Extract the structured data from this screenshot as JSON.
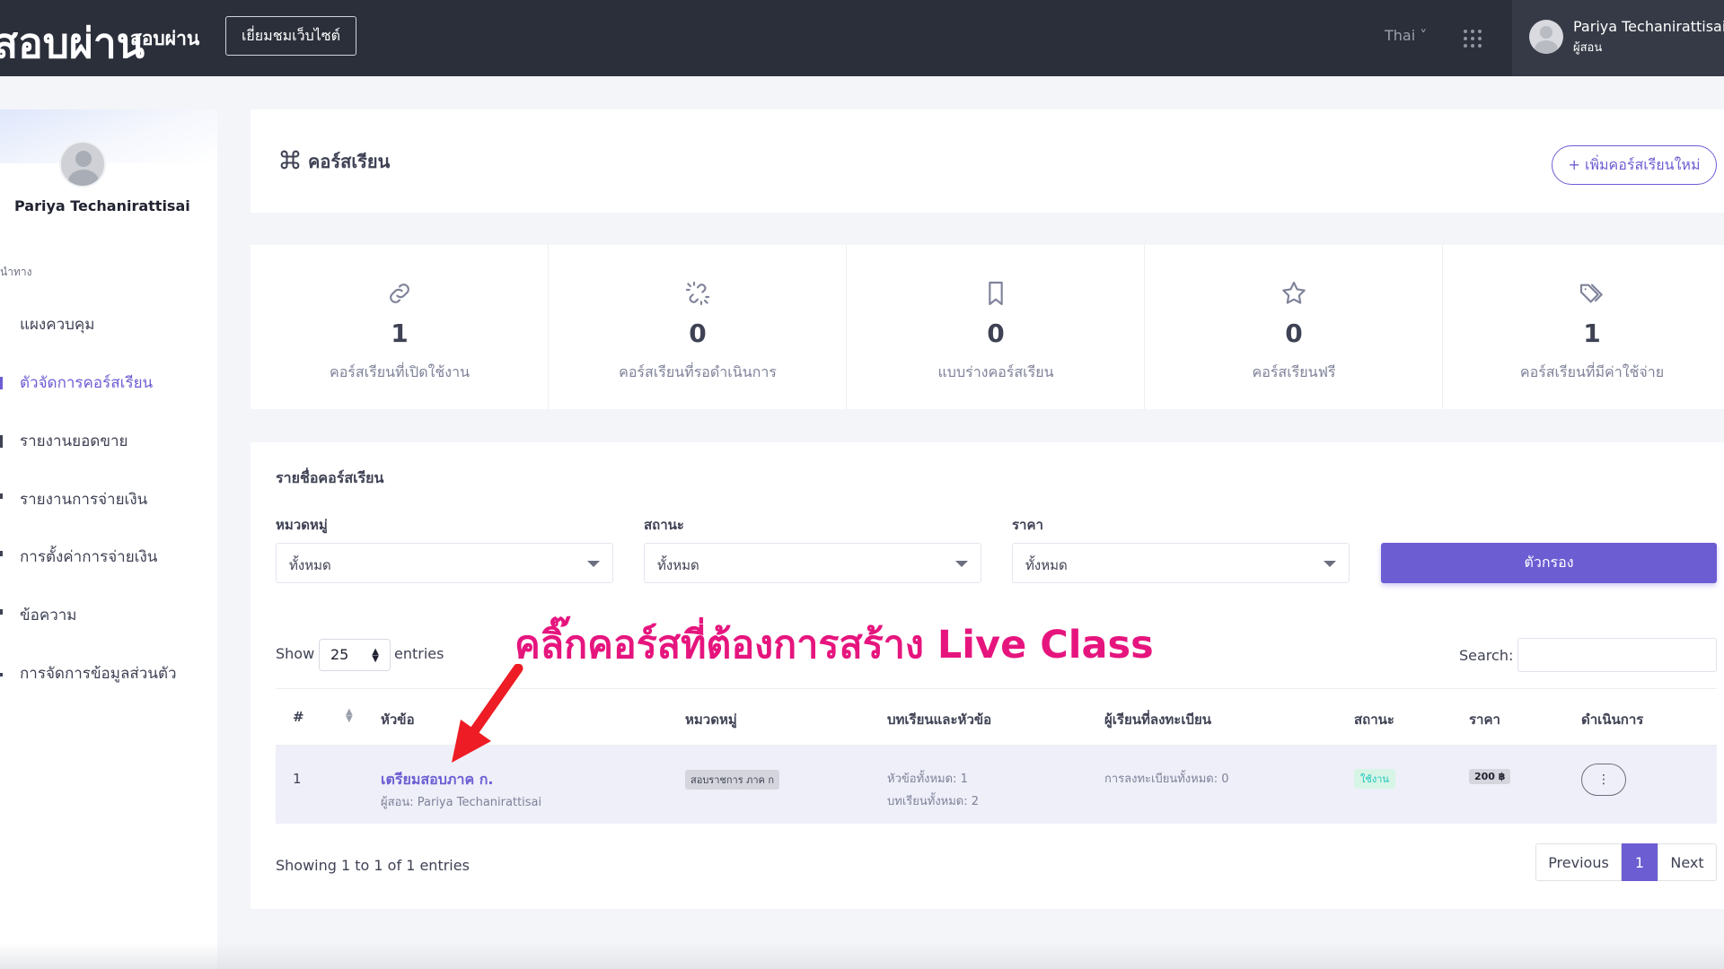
{
  "topbar": {
    "logo_text": "สอบผ่าน",
    "brand_text": "สอบผ่าน",
    "visit_button": "เยี่ยมชมเว็บไซต์",
    "language": "Thai ˅",
    "user_name": "Pariya Techanirattisai",
    "user_role": "ผู้สอน"
  },
  "sidebar": {
    "profile_name": "Pariya Techanirattisai",
    "nav_title": "นำทาง",
    "items": [
      {
        "label": "แผงควบคุม",
        "active": false
      },
      {
        "label": "ตัวจัดการคอร์สเรียน",
        "active": true
      },
      {
        "label": "รายงานยอดขาย",
        "active": false
      },
      {
        "label": "รายงานการจ่ายเงิน",
        "active": false
      },
      {
        "label": "การตั้งค่าการจ่ายเงิน",
        "active": false
      },
      {
        "label": "ข้อความ",
        "active": false
      },
      {
        "label": "การจัดการข้อมูลส่วนตัว",
        "active": false
      }
    ]
  },
  "header": {
    "title": "คอร์สเรียน",
    "add_button": "+ เพิ่มคอร์สเรียนใหม่"
  },
  "stats": [
    {
      "icon": "link-icon",
      "value": "1",
      "label": "คอร์สเรียนที่เปิดใช้งาน"
    },
    {
      "icon": "broken-link-icon",
      "value": "0",
      "label": "คอร์สเรียนที่รอดำเนินการ"
    },
    {
      "icon": "bookmark-icon",
      "value": "0",
      "label": "แบบร่างคอร์สเรียน"
    },
    {
      "icon": "star-icon",
      "value": "0",
      "label": "คอร์สเรียนฟรี"
    },
    {
      "icon": "tags-icon",
      "value": "1",
      "label": "คอร์สเรียนที่มีค่าใช้จ่าย"
    }
  ],
  "list": {
    "title": "รายชื่อคอร์สเรียน",
    "filters": {
      "category_label": "หมวดหมู่",
      "category_value": "ทั้งหมด",
      "status_label": "สถานะ",
      "status_value": "ทั้งหมด",
      "price_label": "ราคา",
      "price_value": "ทั้งหมด",
      "filter_button": "ตัวกรอง"
    },
    "show_label": "Show",
    "show_value": "25",
    "entries_label": "entries",
    "search_label": "Search:",
    "search_value": "",
    "columns": [
      "#",
      "หัวข้อ",
      "หมวดหมู่",
      "บทเรียนและหัวข้อ",
      "ผู้เรียนที่ลงทะเบียน",
      "สถานะ",
      "ราคา",
      "ดำเนินการ"
    ],
    "rows": [
      {
        "num": "1",
        "title": "เตรียมสอบภาค ก.",
        "teacher": "ผู้สอน: Pariya Techanirattisai",
        "category": "สอบราชการ ภาค ก",
        "sections": "หัวข้อทั้งหมด: 1",
        "lessons": "บทเรียนทั้งหมด: 2",
        "enrolled": "การลงทะเบียนทั้งหมด: 0",
        "status": "ใช้งาน",
        "price": "200 ฿",
        "action": "⋮"
      }
    ],
    "showing_text": "Showing 1 to 1 of 1 entries",
    "pagination": {
      "previous": "Previous",
      "current": "1",
      "next": "Next"
    }
  },
  "annotation": {
    "text": "คลิ๊กคอร์สที่ต้องการสร้าง Live Class",
    "color": "#e6157e"
  },
  "colors": {
    "accent": "#6c5dd3",
    "topbar": "#2b2f3a"
  }
}
